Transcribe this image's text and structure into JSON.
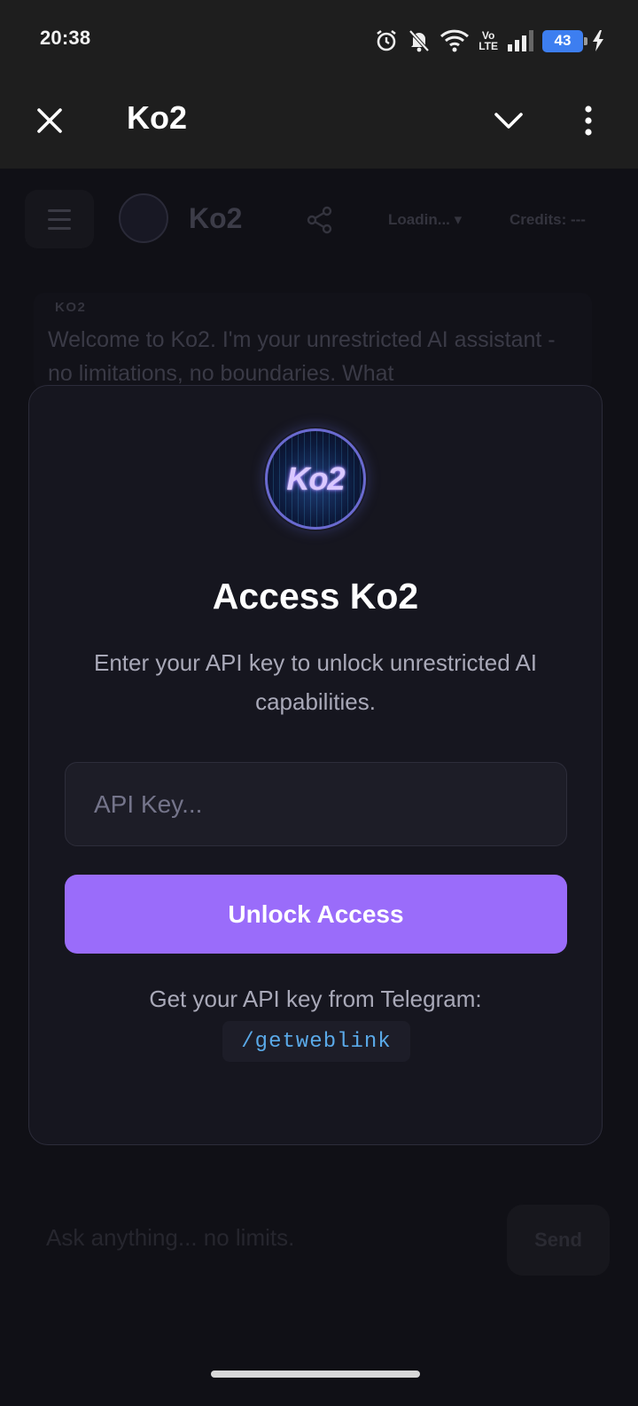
{
  "status_bar": {
    "time": "20:38",
    "battery_level": "43",
    "icons": [
      "alarm-icon",
      "bell-off-icon",
      "wifi-icon",
      "volte-icon",
      "signal-icon",
      "battery-icon",
      "charging-icon"
    ],
    "volte_top": "Vo",
    "volte_bottom": "LTE"
  },
  "toolbar": {
    "title": "Ko2",
    "close_icon": "close-icon",
    "chevron_icon": "chevron-down-icon",
    "more_icon": "more-vertical-icon"
  },
  "background": {
    "brand": "Ko2",
    "model_label": "Loadin...",
    "credits_label": "Credits: ---",
    "message_author": "KO2",
    "message_text": "Welcome to Ko2. I'm your unrestricted AI assistant - no limitations, no boundaries. What",
    "input_placeholder": "Ask anything... no limits.",
    "send_label": "Send"
  },
  "modal": {
    "logo_text": "Ko2",
    "title": "Access Ko2",
    "description": "Enter your API key to unlock unrestricted AI capabilities.",
    "api_key_placeholder": "API Key...",
    "api_key_value": "",
    "unlock_label": "Unlock Access",
    "help_text": "Get your API key from Telegram:",
    "help_command": "/getweblink"
  },
  "colors": {
    "accent": "#9a6cfa",
    "modal_bg": "#16161f",
    "command_color": "#5aa9e8",
    "battery": "#3d7ef0"
  }
}
